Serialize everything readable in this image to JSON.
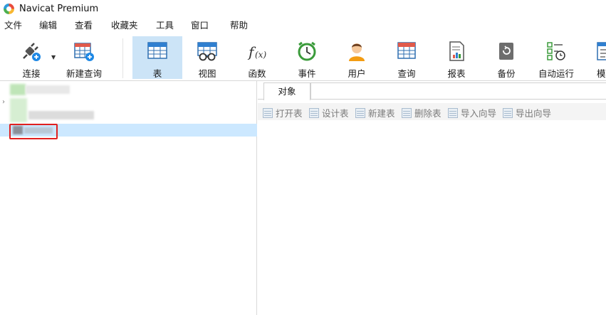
{
  "window": {
    "title": "Navicat Premium"
  },
  "menu": [
    "文件",
    "编辑",
    "查看",
    "收藏夹",
    "工具",
    "窗口",
    "帮助"
  ],
  "toolbar": {
    "connect": "连接",
    "new_query": "新建查询",
    "items": [
      {
        "label": "表",
        "icon": "table-icon",
        "active": true
      },
      {
        "label": "视图",
        "icon": "view-icon"
      },
      {
        "label": "函数",
        "icon": "function-icon"
      },
      {
        "label": "事件",
        "icon": "event-clock-icon"
      },
      {
        "label": "用户",
        "icon": "user-icon"
      },
      {
        "label": "查询",
        "icon": "query-icon"
      },
      {
        "label": "报表",
        "icon": "report-icon"
      },
      {
        "label": "备份",
        "icon": "backup-icon"
      },
      {
        "label": "自动运行",
        "icon": "automation-icon"
      },
      {
        "label": "模",
        "icon": "model-icon"
      }
    ]
  },
  "tabs": {
    "objects": "对象"
  },
  "object_toolbar": [
    "打开表",
    "设计表",
    "新建表",
    "删除表",
    "导入向导",
    "导出向导"
  ],
  "colors": {
    "accent": "#cce4f7",
    "selection": "#cce8ff",
    "highlight_box": "#e02020"
  }
}
